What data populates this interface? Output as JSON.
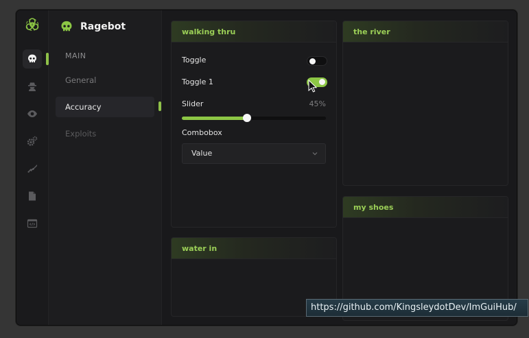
{
  "brand": {
    "title": "Ragebot"
  },
  "nav_icons": [
    "biohazard-icon",
    "skull-icon",
    "spy-icon",
    "eye-icon",
    "gears-icon",
    "rifle-icon",
    "file-icon",
    "code-window-icon"
  ],
  "subnav": {
    "section_label": "MAIN",
    "items": [
      {
        "label": "General"
      },
      {
        "label": "Accuracy"
      },
      {
        "label": "Exploits"
      }
    ]
  },
  "panels": {
    "walking_thru": {
      "title": "walking thru",
      "toggle": {
        "label": "Toggle",
        "on": false
      },
      "toggle1": {
        "label": "Toggle 1",
        "on": true
      },
      "slider": {
        "label": "Slider",
        "value_text": "45%",
        "value": 45
      },
      "combobox": {
        "label": "Combobox",
        "value": "Value"
      }
    },
    "the_river": {
      "title": "the river"
    },
    "my_shoes": {
      "title": "my shoes"
    },
    "water_in": {
      "title": "water in"
    }
  },
  "tooltip": {
    "text": "https://github.com/KingsleydotDev/ImGuiHub/"
  },
  "colors": {
    "accent": "#8cc645",
    "background": "#1b1b1d"
  }
}
